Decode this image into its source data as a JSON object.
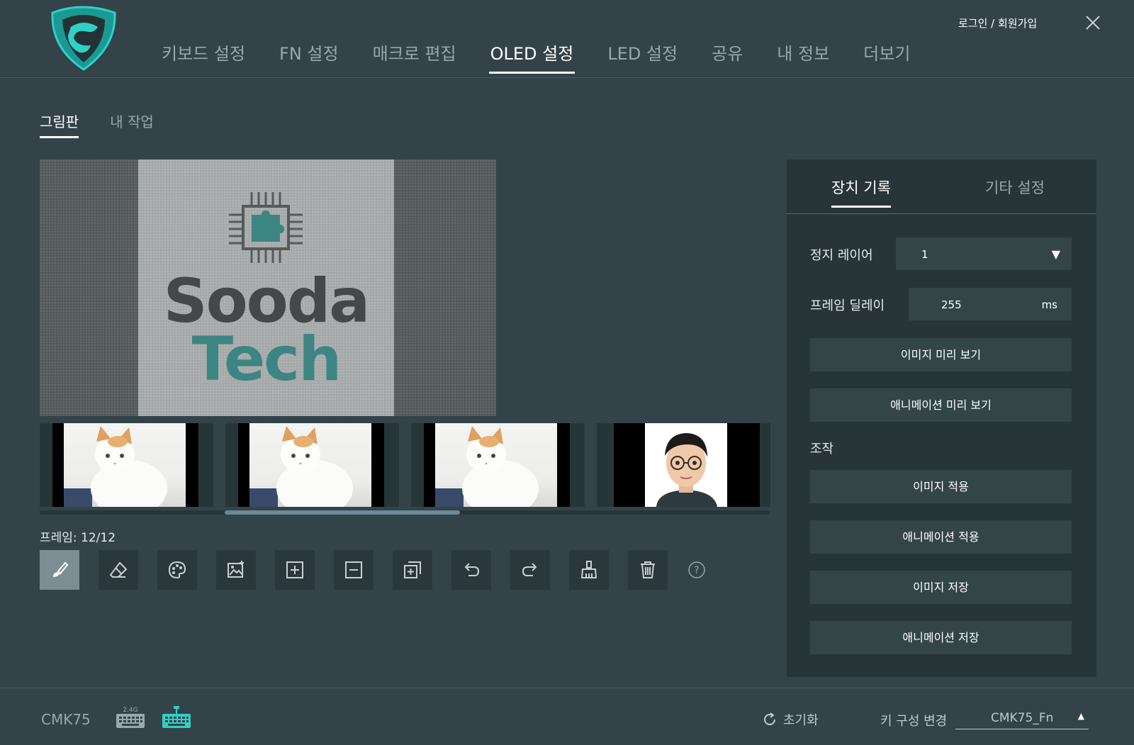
{
  "header": {
    "nav_tabs": [
      {
        "label": "키보드 설정"
      },
      {
        "label": "FN 설정"
      },
      {
        "label": "매크로 편집"
      },
      {
        "label": "OLED 설정",
        "active": true
      },
      {
        "label": "LED 설정"
      },
      {
        "label": "공유"
      },
      {
        "label": "내 정보"
      },
      {
        "label": "더보기"
      }
    ],
    "login_label": "로그인 / 회원가입",
    "close_icon": "close-icon",
    "logo_icon": "snake-shield-logo"
  },
  "subtabs": [
    {
      "label": "그림판",
      "active": true
    },
    {
      "label": "내 작업"
    }
  ],
  "canvas": {
    "text_line1": "Sooda",
    "text_line2": "Tech",
    "chip_icon": "chip-puzzle-icon"
  },
  "filmstrip": {
    "frames": [
      {
        "kind": "cat-photo"
      },
      {
        "kind": "cat-photo"
      },
      {
        "kind": "cat-photo"
      },
      {
        "kind": "avatar-photo"
      }
    ]
  },
  "frame_counter": "프레임: 12/12",
  "tools": [
    {
      "name": "brush-icon",
      "active": true
    },
    {
      "name": "eraser-icon"
    },
    {
      "name": "palette-icon"
    },
    {
      "name": "image-import-icon"
    },
    {
      "name": "add-frame-icon"
    },
    {
      "name": "remove-frame-icon"
    },
    {
      "name": "duplicate-frame-icon"
    },
    {
      "name": "undo-icon"
    },
    {
      "name": "redo-icon"
    },
    {
      "name": "clear-brush-icon"
    },
    {
      "name": "trash-icon"
    },
    {
      "name": "help-icon"
    }
  ],
  "panel": {
    "tabs": [
      {
        "label": "장치 기록",
        "active": true
      },
      {
        "label": "기타 설정"
      }
    ],
    "stop_layer_label": "정지 레이어",
    "stop_layer_value": "1",
    "frame_delay_label": "프레임 딜레이",
    "frame_delay_value": "255",
    "frame_delay_unit": "ms",
    "preview_image_btn": "이미지 미리 보기",
    "preview_anim_btn": "애니메이션 미리 보기",
    "control_label": "조작",
    "apply_image_btn": "이미지 적용",
    "apply_anim_btn": "애니메이션 적용",
    "save_image_btn": "이미지 저장",
    "save_anim_btn": "애니메이션 저장"
  },
  "footer": {
    "device_name": "CMK75",
    "mode_24g_label": "2.4G",
    "reset_label": "초기화",
    "keycfg_label": "키 구성 변경",
    "keycfg_value": "CMK75_Fn"
  },
  "colors": {
    "background": "#334349",
    "panel": "#273538",
    "accent": "#2fd1c6",
    "button": "#344548"
  }
}
